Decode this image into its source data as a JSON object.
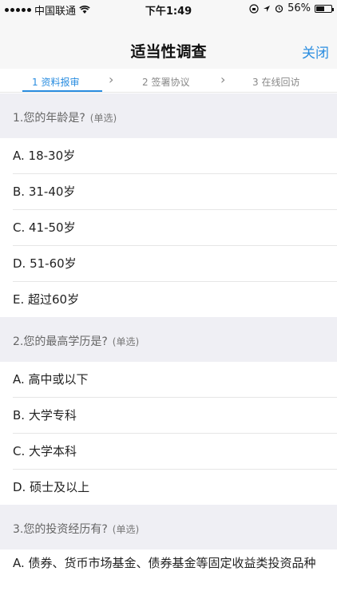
{
  "status_bar": {
    "carrier": "中国联通",
    "time": "下午1:49",
    "battery": "56%",
    "battery_level": 0.56
  },
  "nav": {
    "title": "适当性调查",
    "close_label": "关闭"
  },
  "steps": [
    {
      "label": "1 资料报审"
    },
    {
      "label": "2 签署协议"
    },
    {
      "label": "3 在线回访"
    }
  ],
  "questions": [
    {
      "title": "1.您的年龄是?",
      "type": "(单选)",
      "options": [
        "A. 18-30岁",
        "B. 31-40岁",
        "C. 41-50岁",
        "D. 51-60岁",
        "E. 超过60岁"
      ]
    },
    {
      "title": "2.您的最高学历是?",
      "type": "(单选)",
      "options": [
        "A. 高中或以下",
        "B. 大学专科",
        "C. 大学本科",
        "D. 硕士及以上"
      ]
    },
    {
      "title": "3.您的投资经历有?",
      "type": "(单选)",
      "options": [
        "A. 债券、货币市场基金、债券基金等固定收益类投资品种"
      ]
    }
  ]
}
